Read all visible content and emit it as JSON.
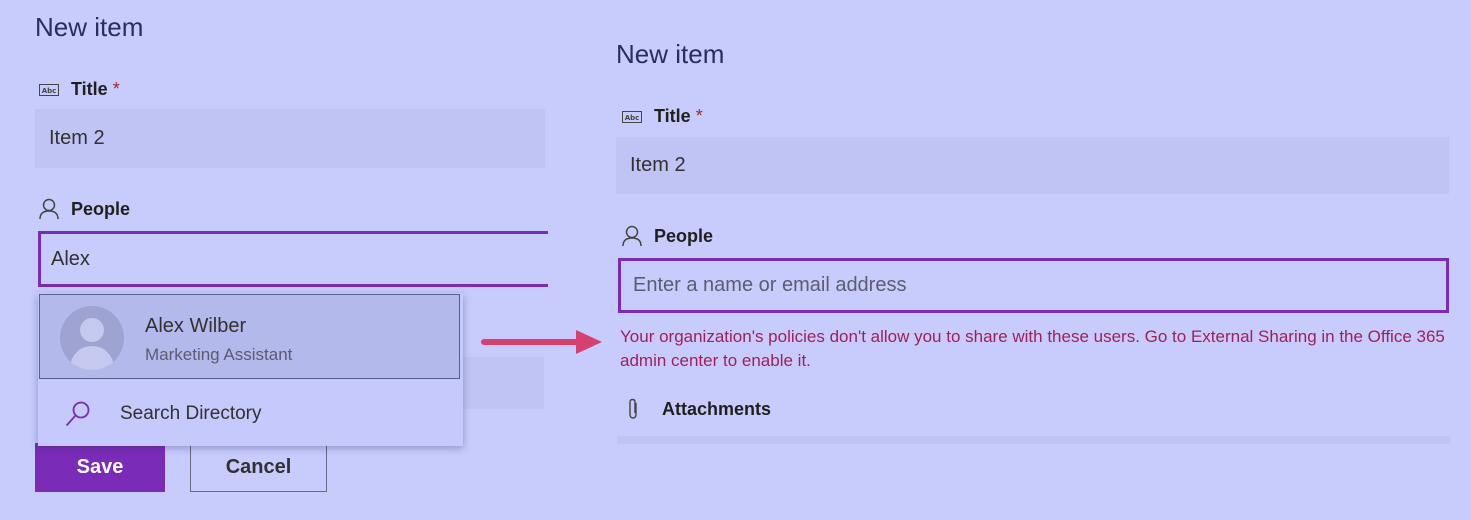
{
  "left": {
    "title": "New item",
    "title_field": {
      "label": "Title",
      "required": "*",
      "value": "Item 2"
    },
    "people_field": {
      "label": "People",
      "value": "Alex"
    },
    "suggestion": {
      "name": "Alex Wilber",
      "subtitle": "Marketing Assistant"
    },
    "search_directory": "Search Directory",
    "save_label": "Save",
    "cancel_label": "Cancel"
  },
  "right": {
    "title": "New item",
    "title_field": {
      "label": "Title",
      "required": "*",
      "value": "Item 2"
    },
    "people_field": {
      "label": "People",
      "placeholder": "Enter a name or email address"
    },
    "error_message": "Your organization's policies don't allow you to share with these users. Go to External Sharing in the Office 365 admin center to enable it.",
    "attachments_label": "Attachments"
  },
  "icons": {
    "title_icon": "abc-text-icon",
    "people_icon": "person-icon",
    "search_icon": "search-icon",
    "attachment_icon": "paperclip-icon",
    "arrow": "arrow-right-icon"
  },
  "colors": {
    "background": "#c8ccfd",
    "accent": "#7a2bb8",
    "error": "#a01f5a",
    "arrow": "#d6416f"
  }
}
